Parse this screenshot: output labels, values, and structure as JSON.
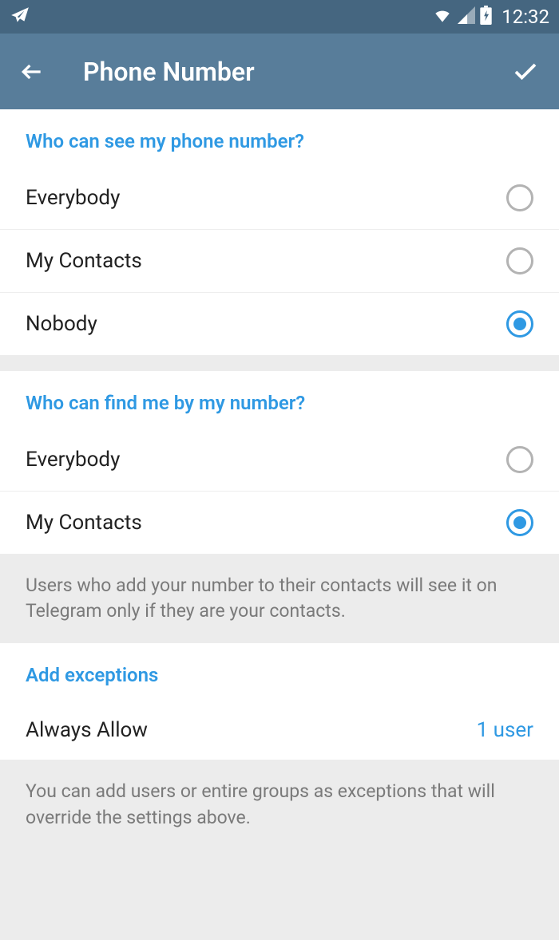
{
  "status": {
    "time": "12:32"
  },
  "header": {
    "title": "Phone Number"
  },
  "section1": {
    "title": "Who can see my phone number?",
    "options": [
      {
        "label": "Everybody",
        "selected": false
      },
      {
        "label": "My Contacts",
        "selected": false
      },
      {
        "label": "Nobody",
        "selected": true
      }
    ]
  },
  "section2": {
    "title": "Who can find me by my number?",
    "options": [
      {
        "label": "Everybody",
        "selected": false
      },
      {
        "label": "My Contacts",
        "selected": true
      }
    ],
    "description": "Users who add your number to their contacts will see it on Telegram only if they are your contacts."
  },
  "section3": {
    "title": "Add exceptions",
    "option": {
      "label": "Always Allow",
      "value": "1 user"
    },
    "description": "You can add users or entire groups as exceptions that will override the settings above."
  }
}
